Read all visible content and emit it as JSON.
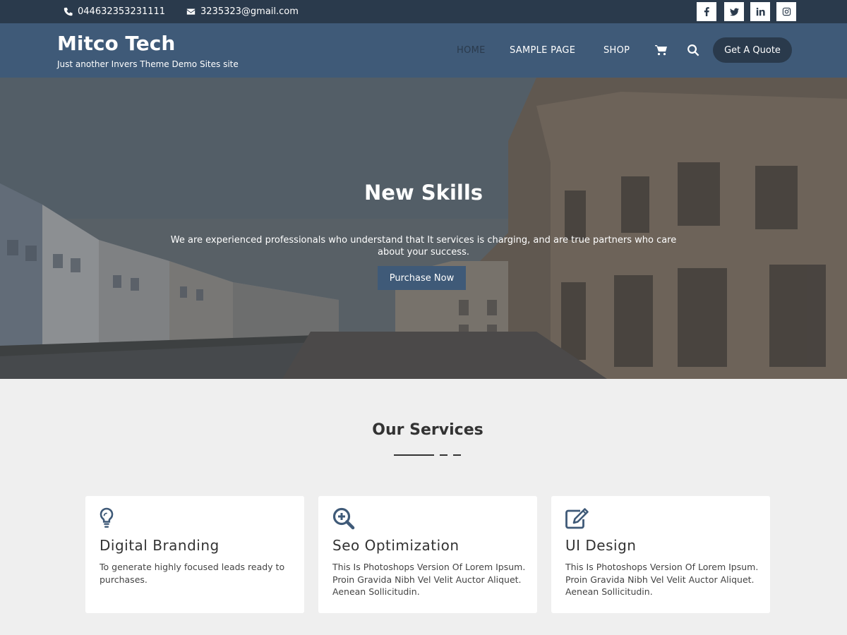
{
  "topbar": {
    "phone": "044632353231111",
    "email": "3235323@gmail.com",
    "social": [
      "facebook-icon",
      "twitter-icon",
      "linkedin-icon",
      "instagram-icon"
    ]
  },
  "header": {
    "site_title": "Mitco Tech",
    "tagline": "Just another Invers Theme Demo Sites site",
    "nav": [
      "HOME",
      "SAMPLE PAGE",
      "SHOP"
    ],
    "active_nav": "HOME",
    "cart_icon": "cart-icon",
    "search_icon": "search-icon",
    "cta": "Get A Quote"
  },
  "hero": {
    "title": "New Skills",
    "text": "We are experienced professionals who understand that It services is charging, and are true partners who care about your success.",
    "button": "Purchase Now"
  },
  "services": {
    "title": "Our Services",
    "cards": [
      {
        "icon": "lightbulb-icon",
        "title": "Digital Branding",
        "desc": "To generate highly focused leads ready to purchases."
      },
      {
        "icon": "zoom-in-icon",
        "title": "Seo Optimization",
        "desc": "This Is Photoshops Version Of Lorem Ipsum. Proin Gravida Nibh Vel Velit Auctor Aliquet. Aenean Sollicitudin."
      },
      {
        "icon": "edit-icon",
        "title": "UI Design",
        "desc": "This Is Photoshops Version Of Lorem Ipsum. Proin Gravida Nibh Vel Velit Auctor Aliquet. Aenean Sollicitudin."
      }
    ]
  },
  "colors": {
    "topbar": "#2a3a4c",
    "header": "#3f5a78",
    "accent": "#3f5a78",
    "background": "#efefef"
  }
}
